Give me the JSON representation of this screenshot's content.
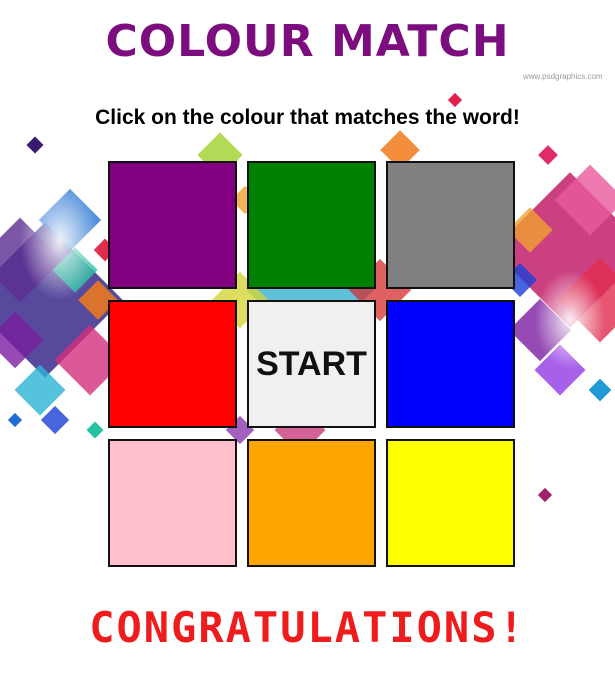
{
  "title": "COLOUR MATCH",
  "watermark": "www.psdgraphics.com",
  "instructions": "Click on the colour that matches the word!",
  "start_label": "START",
  "message": "CONGRATULATIONS!",
  "colors": {
    "title": "#7b0d7e",
    "message": "#ee1c1c"
  },
  "tiles": [
    {
      "id": "purple",
      "color": "#800080"
    },
    {
      "id": "green",
      "color": "#008000"
    },
    {
      "id": "gray",
      "color": "#808080"
    },
    {
      "id": "red",
      "color": "#ff0000"
    },
    {
      "id": "start",
      "color": "#f0f0f0"
    },
    {
      "id": "blue",
      "color": "#0000ff"
    },
    {
      "id": "pink",
      "color": "#ffc0cb"
    },
    {
      "id": "orange",
      "color": "#ffa500"
    },
    {
      "id": "yellow",
      "color": "#ffff00"
    }
  ]
}
